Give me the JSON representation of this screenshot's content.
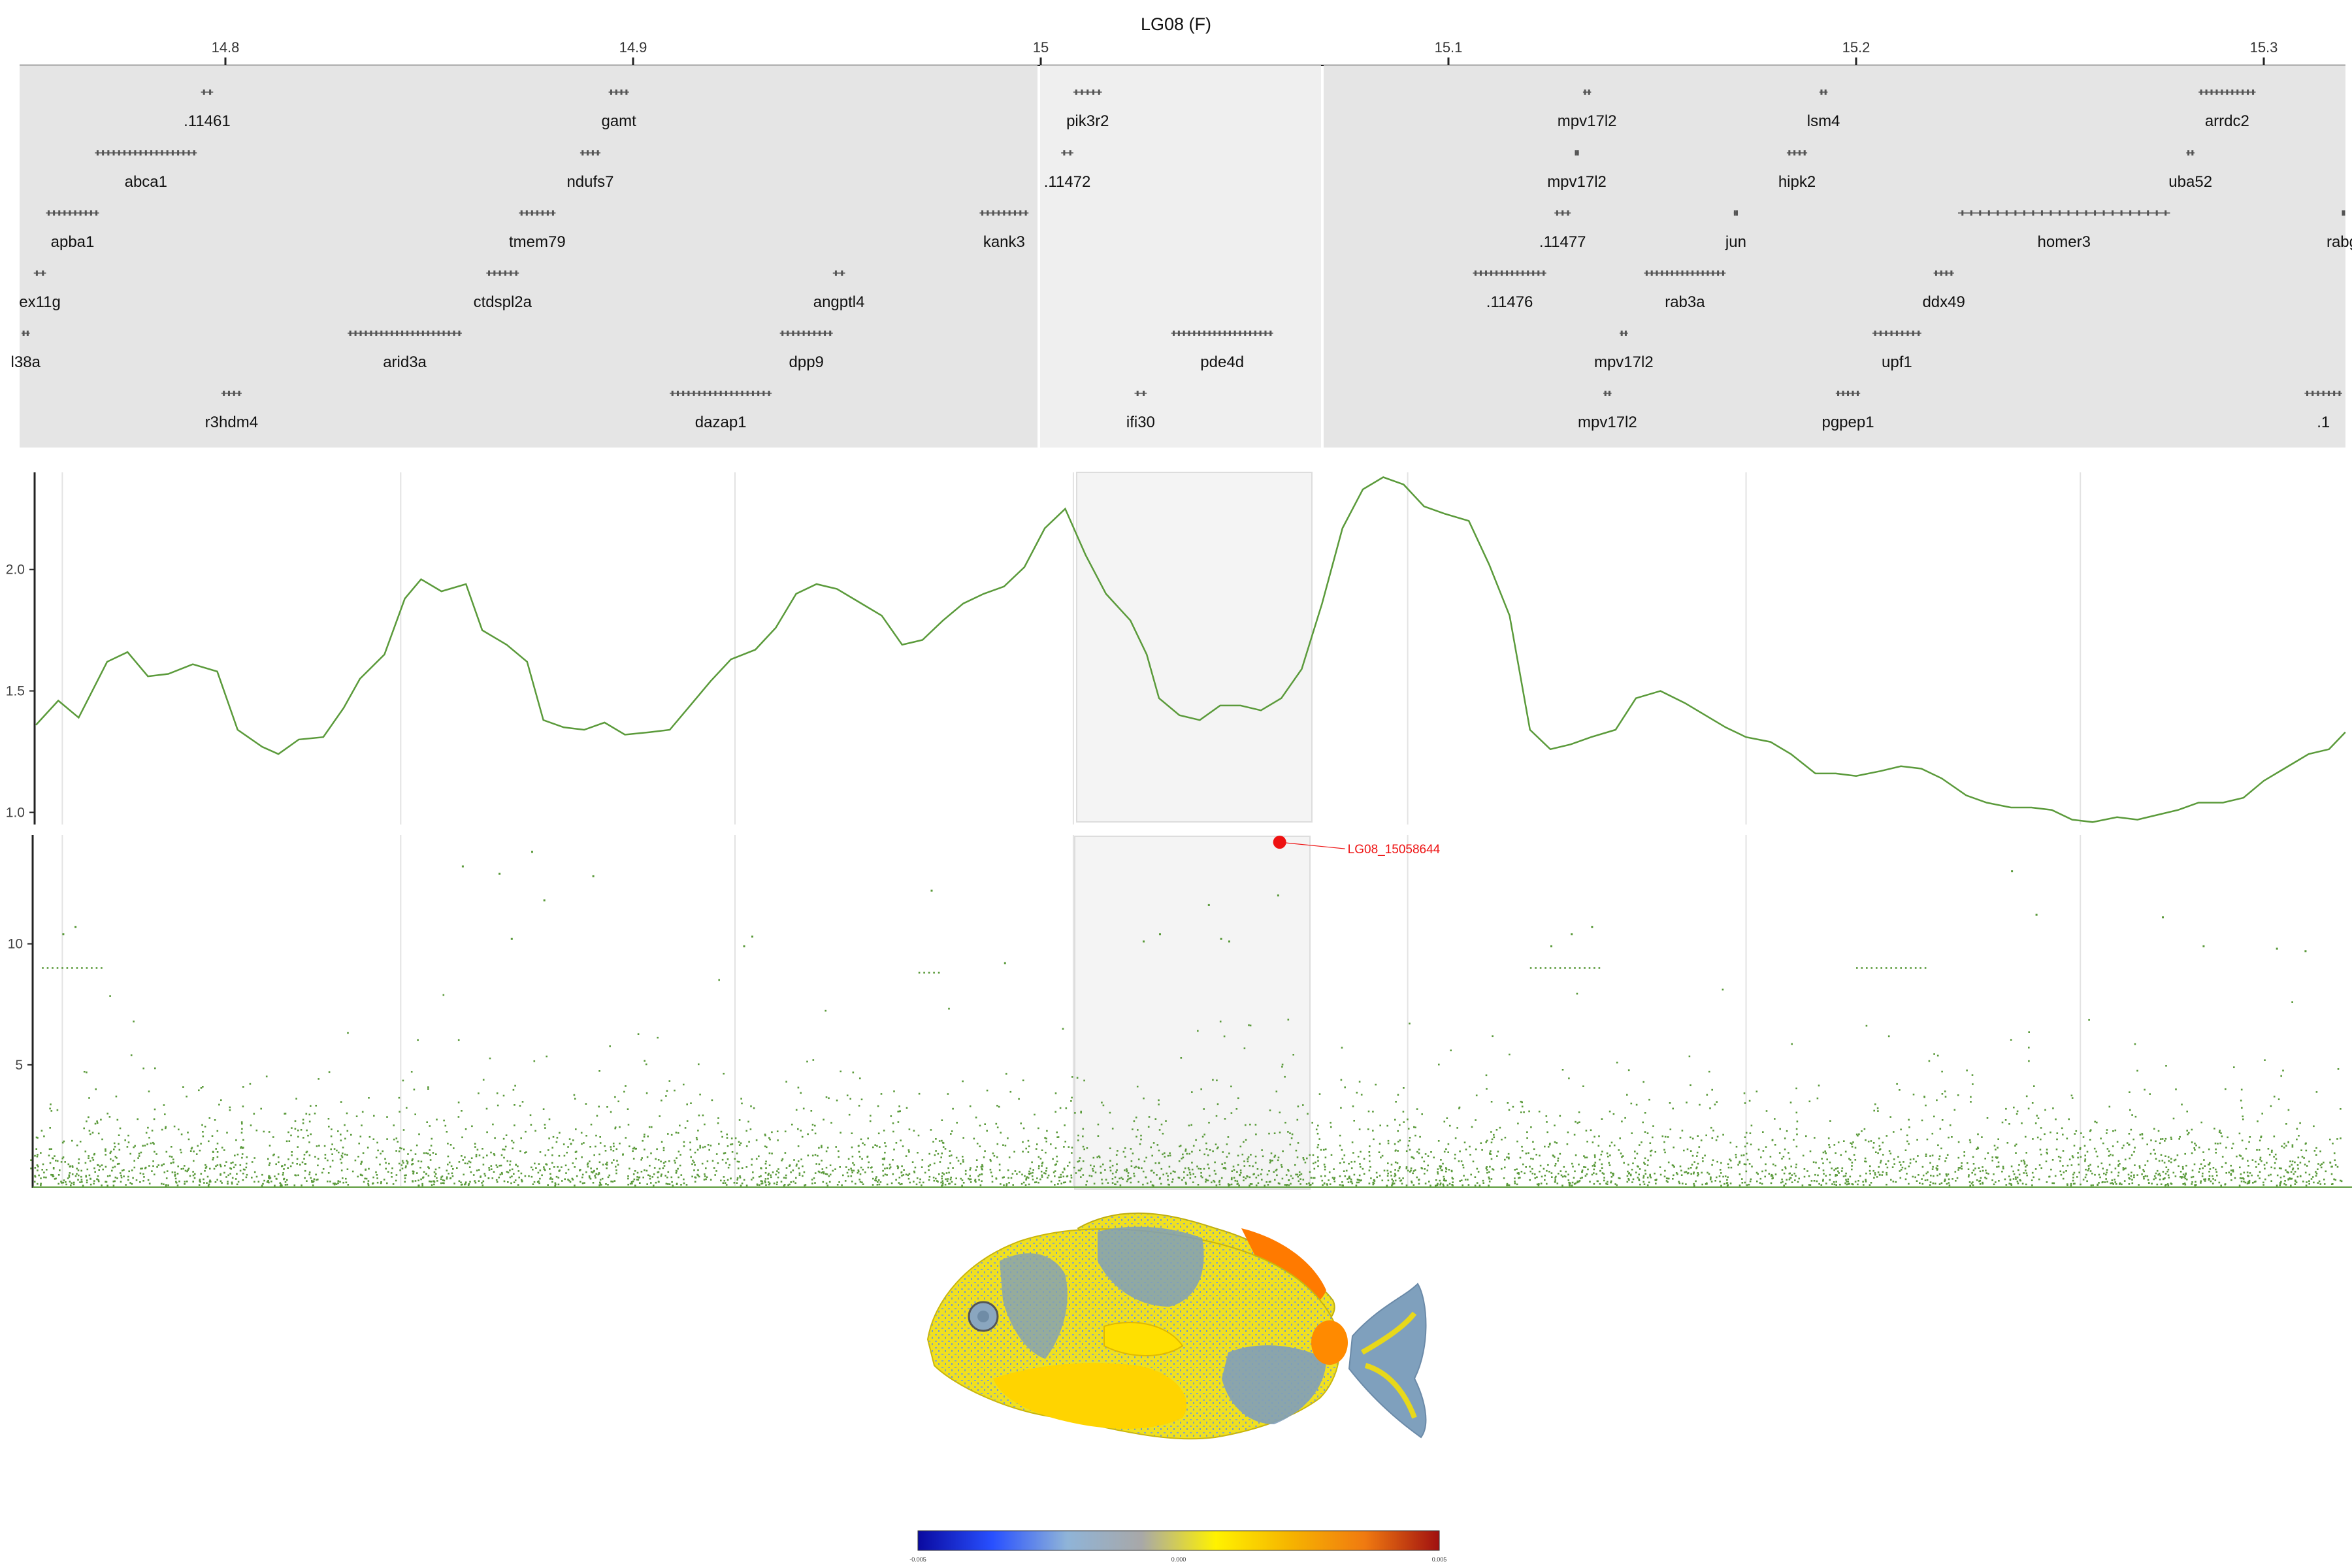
{
  "chart_data": [
    {
      "type": "gene-track",
      "title": "LG08 (F)",
      "xlim": [
        14.75,
        15.32
      ],
      "x_ticks": [
        {
          "value": 14.8,
          "label": "14.8"
        },
        {
          "value": 14.9,
          "label": "14.9"
        },
        {
          "value": 15.0,
          "label": "15"
        },
        {
          "value": 15.1,
          "label": "15.1"
        },
        {
          "value": 15.2,
          "label": "15.2"
        },
        {
          "value": 15.3,
          "label": "15.3"
        }
      ],
      "highlight_region": [
        15.0,
        15.07
      ],
      "genes": [
        {
          "name": ".11461",
          "row": 0,
          "start": 14.794,
          "end": 14.797
        },
        {
          "name": "gamt",
          "row": 0,
          "start": 14.894,
          "end": 14.899
        },
        {
          "name": "pik3r2",
          "row": 0,
          "start": 15.008,
          "end": 15.015
        },
        {
          "name": "mpv17l2",
          "row": 0,
          "start": 15.133,
          "end": 15.135
        },
        {
          "name": "lsm4",
          "row": 0,
          "start": 15.191,
          "end": 15.193
        },
        {
          "name": "arrdc2",
          "row": 0,
          "start": 15.284,
          "end": 15.298
        },
        {
          "name": "abca1",
          "row": 1,
          "start": 14.768,
          "end": 14.793
        },
        {
          "name": "ndufs7",
          "row": 1,
          "start": 14.887,
          "end": 14.892
        },
        {
          "name": ".11472",
          "row": 1,
          "start": 15.005,
          "end": 15.008
        },
        {
          "name": "mpv17l2",
          "row": 1,
          "start": 15.131,
          "end": 15.132
        },
        {
          "name": "hipk2",
          "row": 1,
          "start": 15.183,
          "end": 15.188
        },
        {
          "name": "uba52",
          "row": 1,
          "start": 15.281,
          "end": 15.283
        },
        {
          "name": "apba1",
          "row": 2,
          "start": 14.756,
          "end": 14.769
        },
        {
          "name": "tmem79",
          "row": 2,
          "start": 14.872,
          "end": 14.881
        },
        {
          "name": "kank3",
          "row": 2,
          "start": 14.985,
          "end": 14.997
        },
        {
          "name": ".11477",
          "row": 2,
          "start": 15.126,
          "end": 15.13
        },
        {
          "name": "jun",
          "row": 2,
          "start": 15.17,
          "end": 15.171
        },
        {
          "name": "homer3",
          "row": 2,
          "start": 15.225,
          "end": 15.277
        },
        {
          "name": "rabg",
          "row": 2,
          "start": 15.325,
          "end": 15.33
        },
        {
          "name": "ex11g",
          "row": 3,
          "start": 14.753,
          "end": 14.756
        },
        {
          "name": "ctdspl2a",
          "row": 3,
          "start": 14.864,
          "end": 14.872
        },
        {
          "name": "angptl4",
          "row": 3,
          "start": 14.949,
          "end": 14.952
        },
        {
          "name": ".11476",
          "row": 3,
          "start": 15.106,
          "end": 15.124
        },
        {
          "name": "rab3a",
          "row": 3,
          "start": 15.148,
          "end": 15.168
        },
        {
          "name": "ddx49",
          "row": 3,
          "start": 15.219,
          "end": 15.224
        },
        {
          "name": "l38a",
          "row": 4,
          "start": 14.75,
          "end": 14.752
        },
        {
          "name": "arid3a",
          "row": 4,
          "start": 14.83,
          "end": 14.858
        },
        {
          "name": "dpp9",
          "row": 4,
          "start": 14.936,
          "end": 14.949
        },
        {
          "name": "pde4d",
          "row": 4,
          "start": 15.032,
          "end": 15.057
        },
        {
          "name": "mpv17l2",
          "row": 4,
          "start": 15.142,
          "end": 15.144
        },
        {
          "name": "upf1",
          "row": 4,
          "start": 15.204,
          "end": 15.216
        },
        {
          "name": "r3hdm4",
          "row": 5,
          "start": 14.799,
          "end": 14.804
        },
        {
          "name": "dazap1",
          "row": 5,
          "start": 14.909,
          "end": 14.934
        },
        {
          "name": "ifi30",
          "row": 5,
          "start": 15.023,
          "end": 15.026
        },
        {
          "name": "mpv17l2",
          "row": 5,
          "start": 15.138,
          "end": 15.14
        },
        {
          "name": "pgpep1",
          "row": 5,
          "start": 15.195,
          "end": 15.201
        },
        {
          "name": ".1",
          "row": 5,
          "start": 15.31,
          "end": 15.33
        }
      ]
    },
    {
      "type": "line",
      "title": "",
      "xlabel": "",
      "ylabel": "",
      "xlim": [
        14.75,
        15.32
      ],
      "ylim": [
        0.95,
        2.4
      ],
      "y_ticks": [
        {
          "value": 1.0,
          "label": "1.0"
        },
        {
          "value": 1.5,
          "label": "1.5"
        },
        {
          "value": 2.0,
          "label": "2.0"
        }
      ],
      "grid": "vertical",
      "highlight_region": [
        15.01,
        15.068
      ],
      "color": "#5a9a3a",
      "series": [
        {
          "x": [
            14.75,
            14.759,
            14.764,
            14.771,
            14.776,
            14.781,
            14.786,
            14.792,
            14.798,
            14.803,
            14.809,
            14.813,
            14.818,
            14.824,
            14.829,
            14.833,
            14.839,
            14.844,
            14.848,
            14.853,
            14.859,
            14.863,
            14.869,
            14.874,
            14.878,
            14.883,
            14.888,
            14.893,
            14.898,
            14.904,
            14.909,
            14.914,
            14.919,
            14.924,
            14.93,
            14.935,
            14.94,
            14.945,
            14.95,
            14.955,
            14.961,
            14.966,
            14.971,
            14.976,
            14.981,
            14.986,
            14.991,
            14.996,
            15.001,
            15.006,
            15.011,
            15.016,
            15.022,
            15.026,
            15.029,
            15.034,
            15.039,
            15.044,
            15.049,
            15.054,
            15.059,
            15.064,
            15.069,
            15.074,
            15.079,
            15.084,
            15.089,
            15.094,
            15.099,
            15.105,
            15.11,
            15.115,
            15.12,
            15.125,
            15.13,
            15.135,
            15.141,
            15.146,
            15.152,
            15.158,
            15.163,
            15.168,
            15.173,
            15.179,
            15.184,
            15.19,
            15.195,
            15.2,
            15.206,
            15.211,
            15.216,
            15.221,
            15.227,
            15.232,
            15.238,
            15.243,
            15.248,
            15.253,
            15.258,
            15.264,
            15.269,
            15.274,
            15.279,
            15.284,
            15.29,
            15.295,
            15.3,
            15.305,
            15.311,
            15.316,
            15.32
          ],
          "y": [
            1.36,
            1.46,
            1.39,
            1.62,
            1.66,
            1.56,
            1.57,
            1.61,
            1.58,
            1.34,
            1.27,
            1.24,
            1.3,
            1.31,
            1.43,
            1.55,
            1.65,
            1.88,
            1.96,
            1.91,
            1.94,
            1.75,
            1.69,
            1.62,
            1.38,
            1.35,
            1.34,
            1.37,
            1.32,
            1.33,
            1.34,
            1.44,
            1.54,
            1.63,
            1.67,
            1.76,
            1.9,
            1.94,
            1.92,
            1.87,
            1.81,
            1.69,
            1.71,
            1.79,
            1.86,
            1.9,
            1.93,
            2.01,
            2.17,
            2.25,
            2.06,
            1.9,
            1.79,
            1.65,
            1.47,
            1.4,
            1.38,
            1.44,
            1.44,
            1.42,
            1.47,
            1.59,
            1.86,
            2.17,
            2.33,
            2.38,
            2.35,
            2.26,
            2.23,
            2.2,
            2.02,
            1.81,
            1.34,
            1.26,
            1.28,
            1.31,
            1.34,
            1.47,
            1.5,
            1.45,
            1.4,
            1.35,
            1.31,
            1.29,
            1.24,
            1.16,
            1.16,
            1.15,
            1.17,
            1.19,
            1.18,
            1.14,
            1.07,
            1.04,
            1.02,
            1.02,
            1.01,
            0.97,
            0.96,
            0.98,
            0.97,
            0.99,
            1.01,
            1.04,
            1.04,
            1.06,
            1.13,
            1.18,
            1.24,
            1.26,
            1.33
          ]
        }
      ]
    },
    {
      "type": "scatter",
      "title": "",
      "xlabel": "",
      "ylabel": "",
      "xlim": [
        14.75,
        15.32
      ],
      "ylim": [
        0,
        14.5
      ],
      "y_ticks": [
        {
          "value": 5,
          "label": "5"
        },
        {
          "value": 10,
          "label": "10"
        }
      ],
      "grid": "vertical",
      "highlight_region": [
        15.01,
        15.068
      ],
      "color": "#5a9a3a",
      "point_count": "dense (thousands of points, mostly below 5; horizontal bands near 9 at 14.755-14.77, 15.12-15.137 and 15.2-15.218)",
      "highlight_point": {
        "x": 15.0586,
        "y": 14.2,
        "label": "LG08_15058644",
        "color": "#ee1111"
      },
      "notable_points": [
        {
          "x": 14.763,
          "y": 10.7
        },
        {
          "x": 14.76,
          "y": 10.4
        },
        {
          "x": 14.858,
          "y": 13.2
        },
        {
          "x": 14.867,
          "y": 12.9
        },
        {
          "x": 14.875,
          "y": 13.8
        },
        {
          "x": 14.878,
          "y": 11.8
        },
        {
          "x": 14.89,
          "y": 12.8
        },
        {
          "x": 14.87,
          "y": 10.2
        },
        {
          "x": 14.927,
          "y": 9.9
        },
        {
          "x": 14.929,
          "y": 10.3
        },
        {
          "x": 14.973,
          "y": 12.2
        },
        {
          "x": 14.991,
          "y": 9.2
        },
        {
          "x": 15.025,
          "y": 10.1
        },
        {
          "x": 15.029,
          "y": 10.4
        },
        {
          "x": 15.041,
          "y": 11.6
        },
        {
          "x": 15.044,
          "y": 10.2
        },
        {
          "x": 15.046,
          "y": 10.1
        },
        {
          "x": 15.058,
          "y": 12.0
        },
        {
          "x": 15.13,
          "y": 10.4
        },
        {
          "x": 15.135,
          "y": 10.7
        },
        {
          "x": 15.125,
          "y": 9.9
        },
        {
          "x": 15.238,
          "y": 13.0
        },
        {
          "x": 15.244,
          "y": 11.2
        },
        {
          "x": 15.275,
          "y": 11.1
        },
        {
          "x": 15.285,
          "y": 9.9
        },
        {
          "x": 15.303,
          "y": 9.8
        },
        {
          "x": 15.31,
          "y": 9.7
        }
      ]
    },
    {
      "type": "heatmap",
      "title": "",
      "colorbar": {
        "min_label": "-0.005",
        "mid_label": "0.000",
        "max_label": "0.005",
        "colors": [
          "#0a0aa0",
          "#2850ff",
          "#8fb4d8",
          "#a8a8a8",
          "#fff200",
          "#f6b400",
          "#f07a10",
          "#a01010"
        ]
      },
      "image": {
        "subject": "fish",
        "fill_colors": [
          "#f2e21c",
          "#7fa0bd",
          "#ff7a00",
          "#ffe000"
        ]
      }
    }
  ]
}
